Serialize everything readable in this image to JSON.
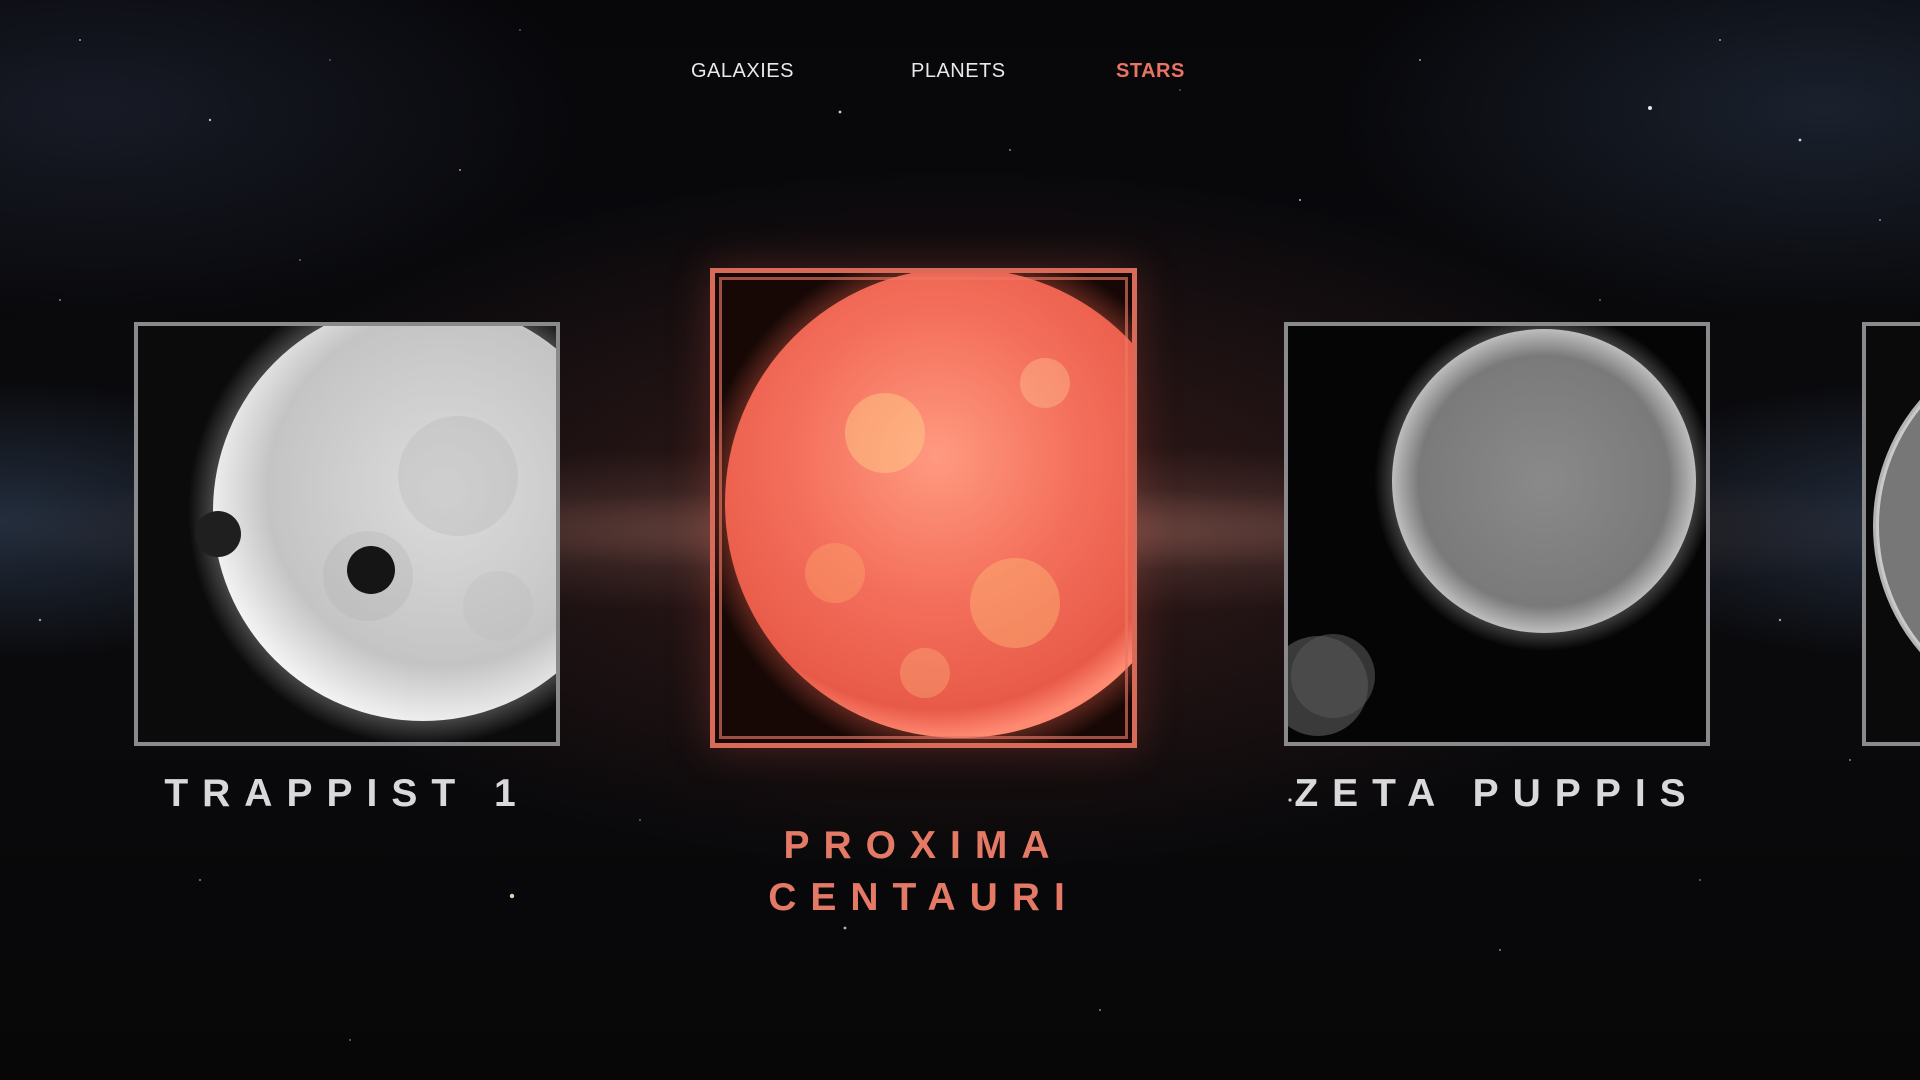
{
  "nav": {
    "items": [
      {
        "label": "GALAXIES",
        "active": false
      },
      {
        "label": "PLANETS",
        "active": false
      },
      {
        "label": "STARS",
        "active": true
      }
    ],
    "active_color": "#e87463"
  },
  "cards": {
    "left": {
      "title": "TRAPPIST 1"
    },
    "center": {
      "title_line1": "PROXIMA",
      "title_line2": "CENTAURI"
    },
    "right": {
      "title": "ZETA PUPPIS"
    }
  },
  "colors": {
    "accent": "#e47a66",
    "frame_inactive": "#8a8a8c",
    "frame_active": "#d86a5a"
  }
}
